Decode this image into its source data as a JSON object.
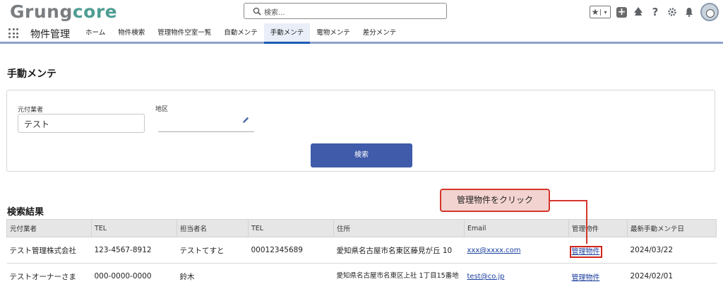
{
  "brand": {
    "part1": "Grung",
    "part2": "core"
  },
  "search": {
    "placeholder": "検索..."
  },
  "nav": {
    "app_name": "物件管理",
    "tabs": [
      {
        "label": "ホーム"
      },
      {
        "label": "物件検索"
      },
      {
        "label": "管理物件空室一覧"
      },
      {
        "label": "自動メンテ"
      },
      {
        "label": "手動メンテ",
        "active": true
      },
      {
        "label": "電物メンテ"
      },
      {
        "label": "差分メンテ"
      }
    ]
  },
  "page": {
    "title": "手動メンテ"
  },
  "form": {
    "contractor_label": "元付業者",
    "contractor_value": "テスト",
    "area_label": "地区",
    "search_button": "検索"
  },
  "results": {
    "title": "検索結果",
    "columns": [
      "元付業者",
      "TEL",
      "担当者名",
      "TEL",
      "住所",
      "Email",
      "管理物件",
      "最新手動メンテ日"
    ],
    "rows": [
      {
        "contractor": "テスト管理株式会社",
        "tel": "123-4567-8912",
        "person": "テストてすと",
        "tel2": "00012345689",
        "address": "愛知県名古屋市名東区藤見が丘 10",
        "email": "xxx@xxxx.com",
        "property": "管理物件",
        "date": "2024/03/22"
      },
      {
        "contractor": "テストオーナーさま",
        "tel": "000-0000-0000",
        "person": "鈴木",
        "tel2": "",
        "address": "愛知県名古屋市名東区上社 1丁目15番地",
        "email": "test@co.jp",
        "property": "管理物件",
        "date": "2024/02/01"
      }
    ]
  },
  "callout": {
    "text": "管理物件をクリック"
  },
  "colors": {
    "accent": "#3f5ba9",
    "callout_border": "#d5362c",
    "link": "#1a3f9e"
  },
  "icons": [
    "search-icon",
    "favorite-star-icon",
    "add-icon",
    "trailhead-icon",
    "help-icon",
    "settings-icon",
    "bell-icon",
    "avatar",
    "app-launcher-icon",
    "pencil-icon"
  ]
}
